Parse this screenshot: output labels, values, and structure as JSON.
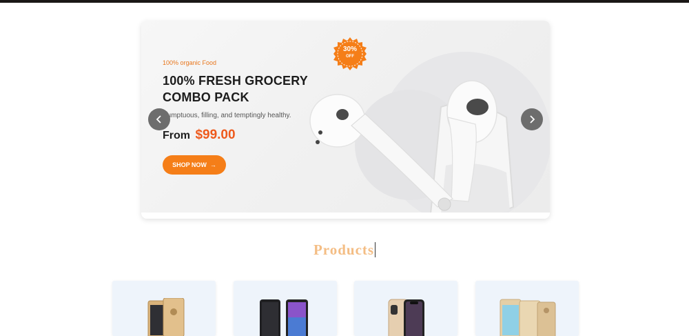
{
  "hero": {
    "eyebrow": "100% organic Food",
    "headline_line1": "100% FRESH GROCERY",
    "headline_line2": "COMBO PACK",
    "tagline": "Sumptuous, filling, and temptingly healthy.",
    "price_prefix": "From",
    "price": "$99.00",
    "cta_label": "SHOP NOW",
    "cta_arrow": "→",
    "badge_percent": "30%",
    "badge_off": "OFF"
  },
  "section": {
    "title": "Products"
  },
  "colors": {
    "accent_orange": "#f57e18",
    "price_orange": "#ee5a1d",
    "section_title": "#f4bd84",
    "nav_button": "#6d6d6d"
  },
  "products": [
    {
      "icon": "gold-smartphone-icon"
    },
    {
      "icon": "black-smartphone-icon"
    },
    {
      "icon": "gold-iphone-icon"
    },
    {
      "icon": "gold-android-phone-icon"
    }
  ]
}
